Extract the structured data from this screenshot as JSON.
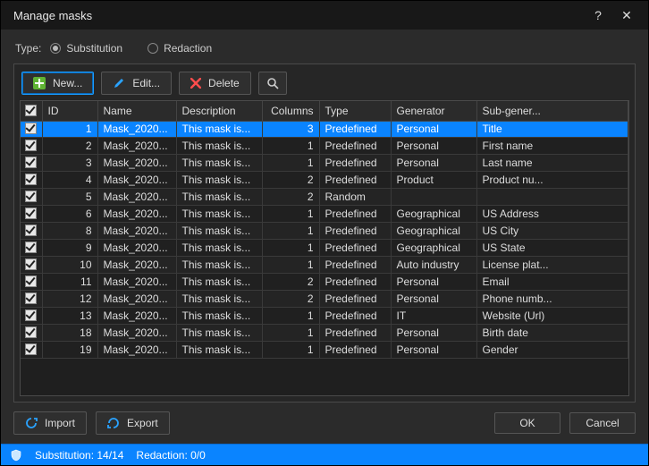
{
  "title": "Manage masks",
  "type_label": "Type:",
  "radios": {
    "substitution": "Substitution",
    "redaction": "Redaction",
    "selected": "substitution"
  },
  "toolbar": {
    "new_label": "New...",
    "edit_label": "Edit...",
    "delete_label": "Delete"
  },
  "headers": {
    "id": "ID",
    "name": "Name",
    "description": "Description",
    "columns": "Columns",
    "type": "Type",
    "generator": "Generator",
    "sub_generator": "Sub-gener..."
  },
  "rows": [
    {
      "checked": true,
      "selected": true,
      "id": 1,
      "name": "Mask_2020...",
      "desc": "This mask is...",
      "cols": 3,
      "type": "Predefined",
      "gen": "Personal",
      "sub": "Title"
    },
    {
      "checked": true,
      "selected": false,
      "id": 2,
      "name": "Mask_2020...",
      "desc": "This mask is...",
      "cols": 1,
      "type": "Predefined",
      "gen": "Personal",
      "sub": "First name"
    },
    {
      "checked": true,
      "selected": false,
      "id": 3,
      "name": "Mask_2020...",
      "desc": "This mask is...",
      "cols": 1,
      "type": "Predefined",
      "gen": "Personal",
      "sub": "Last name"
    },
    {
      "checked": true,
      "selected": false,
      "id": 4,
      "name": "Mask_2020...",
      "desc": "This mask is...",
      "cols": 2,
      "type": "Predefined",
      "gen": "Product",
      "sub": "Product nu..."
    },
    {
      "checked": true,
      "selected": false,
      "id": 5,
      "name": "Mask_2020...",
      "desc": "This mask is...",
      "cols": 2,
      "type": "Random",
      "gen": "",
      "sub": ""
    },
    {
      "checked": true,
      "selected": false,
      "id": 6,
      "name": "Mask_2020...",
      "desc": "This mask is...",
      "cols": 1,
      "type": "Predefined",
      "gen": "Geographical",
      "sub": "US Address"
    },
    {
      "checked": true,
      "selected": false,
      "id": 8,
      "name": "Mask_2020...",
      "desc": "This mask is...",
      "cols": 1,
      "type": "Predefined",
      "gen": "Geographical",
      "sub": "US City"
    },
    {
      "checked": true,
      "selected": false,
      "id": 9,
      "name": "Mask_2020...",
      "desc": "This mask is...",
      "cols": 1,
      "type": "Predefined",
      "gen": "Geographical",
      "sub": "US State"
    },
    {
      "checked": true,
      "selected": false,
      "id": 10,
      "name": "Mask_2020...",
      "desc": "This mask is...",
      "cols": 1,
      "type": "Predefined",
      "gen": "Auto industry",
      "sub": "License plat..."
    },
    {
      "checked": true,
      "selected": false,
      "id": 11,
      "name": "Mask_2020...",
      "desc": "This mask is...",
      "cols": 2,
      "type": "Predefined",
      "gen": "Personal",
      "sub": "Email"
    },
    {
      "checked": true,
      "selected": false,
      "id": 12,
      "name": "Mask_2020...",
      "desc": "This mask is...",
      "cols": 2,
      "type": "Predefined",
      "gen": "Personal",
      "sub": "Phone numb..."
    },
    {
      "checked": true,
      "selected": false,
      "id": 13,
      "name": "Mask_2020...",
      "desc": "This mask is...",
      "cols": 1,
      "type": "Predefined",
      "gen": "IT",
      "sub": "Website (Url)"
    },
    {
      "checked": true,
      "selected": false,
      "id": 18,
      "name": "Mask_2020...",
      "desc": "This mask is...",
      "cols": 1,
      "type": "Predefined",
      "gen": "Personal",
      "sub": "Birth date"
    },
    {
      "checked": true,
      "selected": false,
      "id": 19,
      "name": "Mask_2020...",
      "desc": "This mask is...",
      "cols": 1,
      "type": "Predefined",
      "gen": "Personal",
      "sub": "Gender"
    }
  ],
  "import_label": "Import",
  "export_label": "Export",
  "ok_label": "OK",
  "cancel_label": "Cancel",
  "status": {
    "substitution": "Substitution: 14/14",
    "redaction": "Redaction: 0/0"
  }
}
